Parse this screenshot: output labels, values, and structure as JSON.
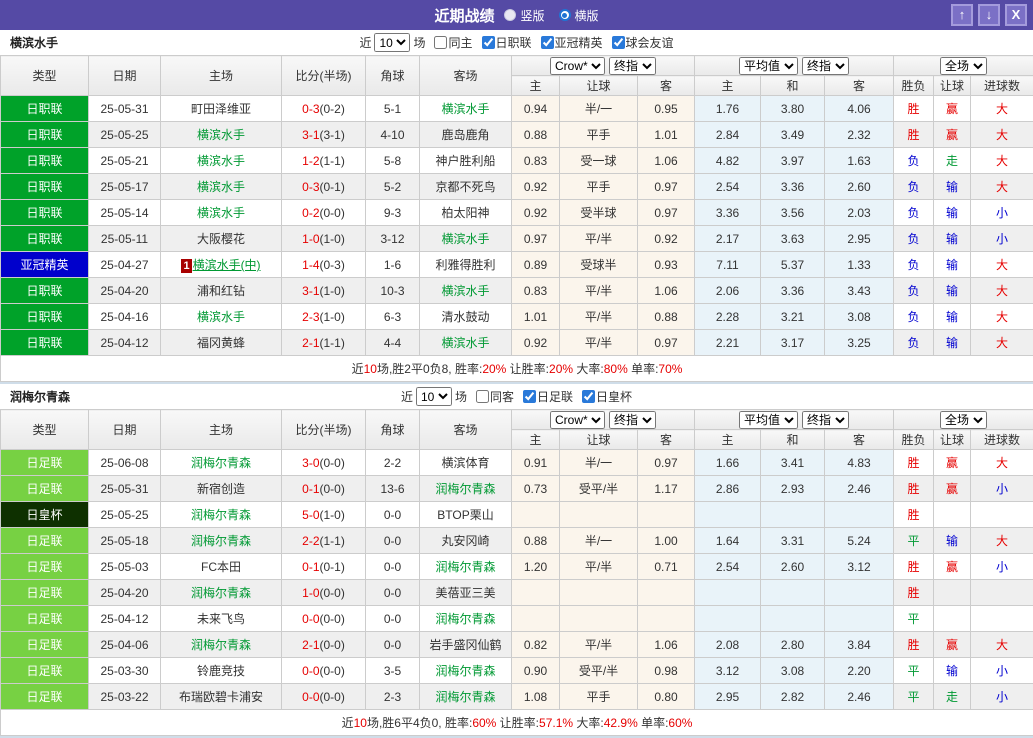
{
  "titlebar": {
    "title": "近期战绩",
    "radios": [
      {
        "label": "竖版",
        "selected": false
      },
      {
        "label": "横版",
        "selected": true
      }
    ],
    "buttons": {
      "up": "↑",
      "down": "↓",
      "close": "X"
    }
  },
  "colors": {
    "header_purple": "#554aa5",
    "badge": {
      "日职联": "#00a229",
      "亚冠精英": "#0000cc",
      "日足联": "#77d143",
      "日皇杯": "#0e3000"
    },
    "score_red": "#e60000",
    "team_green": "#009933",
    "result_red": "#e60000",
    "result_blue": "#0000d0",
    "result_green": "#009933"
  },
  "table_headers": {
    "main": [
      "类型",
      "日期",
      "主场",
      "比分(半场)",
      "角球",
      "客场"
    ],
    "sub": [
      "主",
      "让球",
      "客",
      "主",
      "和",
      "客",
      "胜负",
      "让球",
      "进球数"
    ],
    "group_selects": {
      "crow": [
        "Crow*",
        "终指"
      ],
      "avg": [
        "平均值",
        "终指"
      ],
      "result": [
        "全场"
      ]
    }
  },
  "sections": [
    {
      "team": "横滨水手",
      "filter": {
        "near_label": "近",
        "count": "10",
        "unit_label": "场",
        "checkboxes": [
          {
            "label": "同主",
            "checked": false
          },
          {
            "label": "日职联",
            "checked": true
          },
          {
            "label": "亚冠精英",
            "checked": true
          },
          {
            "label": "球会友谊",
            "checked": true
          }
        ]
      },
      "rows": [
        {
          "type": "日职联",
          "date": "25-05-31",
          "home": {
            "name": "町田泽维亚"
          },
          "score": "0-3",
          "half": "(0-2)",
          "corner": "5-1",
          "away": {
            "name": "横滨水手",
            "hl": true
          },
          "odds": [
            "0.94",
            "半/一",
            "0.95"
          ],
          "avg": [
            "1.76",
            "3.80",
            "4.06"
          ],
          "results": [
            "胜",
            "赢",
            "大"
          ]
        },
        {
          "type": "日职联",
          "date": "25-05-25",
          "home": {
            "name": "横滨水手",
            "hl": true
          },
          "score": "3-1",
          "half": "(3-1)",
          "corner": "4-10",
          "away": {
            "name": "鹿岛鹿角"
          },
          "odds": [
            "0.88",
            "平手",
            "1.01"
          ],
          "avg": [
            "2.84",
            "3.49",
            "2.32"
          ],
          "results": [
            "胜",
            "赢",
            "大"
          ]
        },
        {
          "type": "日职联",
          "date": "25-05-21",
          "home": {
            "name": "横滨水手",
            "hl": true
          },
          "score": "1-2",
          "half": "(1-1)",
          "corner": "5-8",
          "away": {
            "name": "神户胜利船"
          },
          "odds": [
            "0.83",
            "受一球",
            "1.06"
          ],
          "avg": [
            "4.82",
            "3.97",
            "1.63"
          ],
          "results": [
            "负",
            "走",
            "大"
          ]
        },
        {
          "type": "日职联",
          "date": "25-05-17",
          "home": {
            "name": "横滨水手",
            "hl": true
          },
          "score": "0-3",
          "half": "(0-1)",
          "corner": "5-2",
          "away": {
            "name": "京都不死鸟"
          },
          "odds": [
            "0.92",
            "平手",
            "0.97"
          ],
          "avg": [
            "2.54",
            "3.36",
            "2.60"
          ],
          "results": [
            "负",
            "输",
            "大"
          ]
        },
        {
          "type": "日职联",
          "date": "25-05-14",
          "home": {
            "name": "横滨水手",
            "hl": true
          },
          "score": "0-2",
          "half": "(0-0)",
          "corner": "9-3",
          "away": {
            "name": "柏太阳神"
          },
          "odds": [
            "0.92",
            "受半球",
            "0.97"
          ],
          "avg": [
            "3.36",
            "3.56",
            "2.03"
          ],
          "results": [
            "负",
            "输",
            "小"
          ]
        },
        {
          "type": "日职联",
          "date": "25-05-11",
          "home": {
            "name": "大阪樱花"
          },
          "score": "1-0",
          "half": "(1-0)",
          "corner": "3-12",
          "away": {
            "name": "横滨水手",
            "hl": true
          },
          "odds": [
            "0.97",
            "平/半",
            "0.92"
          ],
          "avg": [
            "2.17",
            "3.63",
            "2.95"
          ],
          "results": [
            "负",
            "输",
            "小"
          ]
        },
        {
          "type": "亚冠精英",
          "date": "25-04-27",
          "home": {
            "name": "横滨水手(中)",
            "hl": true,
            "mark": "1",
            "underline": true
          },
          "score": "1-4",
          "half": "(0-3)",
          "corner": "1-6",
          "away": {
            "name": "利雅得胜利"
          },
          "odds": [
            "0.89",
            "受球半",
            "0.93"
          ],
          "avg": [
            "7.11",
            "5.37",
            "1.33"
          ],
          "results": [
            "负",
            "输",
            "大"
          ]
        },
        {
          "type": "日职联",
          "date": "25-04-20",
          "home": {
            "name": "浦和红钻"
          },
          "score": "3-1",
          "half": "(1-0)",
          "corner": "10-3",
          "away": {
            "name": "横滨水手",
            "hl": true
          },
          "odds": [
            "0.83",
            "平/半",
            "1.06"
          ],
          "avg": [
            "2.06",
            "3.36",
            "3.43"
          ],
          "results": [
            "负",
            "输",
            "大"
          ]
        },
        {
          "type": "日职联",
          "date": "25-04-16",
          "home": {
            "name": "横滨水手",
            "hl": true
          },
          "score": "2-3",
          "half": "(1-0)",
          "corner": "6-3",
          "away": {
            "name": "清水鼓动"
          },
          "odds": [
            "1.01",
            "平/半",
            "0.88"
          ],
          "avg": [
            "2.28",
            "3.21",
            "3.08"
          ],
          "results": [
            "负",
            "输",
            "大"
          ]
        },
        {
          "type": "日职联",
          "date": "25-04-12",
          "home": {
            "name": "福冈黄蜂"
          },
          "score": "2-1",
          "half": "(1-1)",
          "corner": "4-4",
          "away": {
            "name": "横滨水手",
            "hl": true
          },
          "odds": [
            "0.92",
            "平/半",
            "0.97"
          ],
          "avg": [
            "2.21",
            "3.17",
            "3.25"
          ],
          "results": [
            "负",
            "输",
            "大"
          ]
        }
      ],
      "summary": [
        {
          "t": "近"
        },
        {
          "t": "10",
          "red": true
        },
        {
          "t": "场,胜2平0负8, 胜率:"
        },
        {
          "t": "20%",
          "red": true
        },
        {
          "t": " 让胜率:"
        },
        {
          "t": "20%",
          "red": true
        },
        {
          "t": " 大率:"
        },
        {
          "t": "80%",
          "red": true
        },
        {
          "t": " 单率:"
        },
        {
          "t": "70%",
          "red": true
        }
      ]
    },
    {
      "team": "润梅尔青森",
      "filter": {
        "near_label": "近",
        "count": "10",
        "unit_label": "场",
        "checkboxes": [
          {
            "label": "同客",
            "checked": false
          },
          {
            "label": "日足联",
            "checked": true
          },
          {
            "label": "日皇杯",
            "checked": true
          }
        ]
      },
      "rows": [
        {
          "type": "日足联",
          "date": "25-06-08",
          "home": {
            "name": "润梅尔青森",
            "hl": true
          },
          "score": "3-0",
          "half": "(0-0)",
          "corner": "2-2",
          "away": {
            "name": "横滨体育"
          },
          "odds": [
            "0.91",
            "半/一",
            "0.97"
          ],
          "avg": [
            "1.66",
            "3.41",
            "4.83"
          ],
          "results": [
            "胜",
            "赢",
            "大"
          ]
        },
        {
          "type": "日足联",
          "date": "25-05-31",
          "home": {
            "name": "新宿创造"
          },
          "score": "0-1",
          "half": "(0-0)",
          "corner": "13-6",
          "away": {
            "name": "润梅尔青森",
            "hl": true
          },
          "odds": [
            "0.73",
            "受平/半",
            "1.17"
          ],
          "avg": [
            "2.86",
            "2.93",
            "2.46"
          ],
          "results": [
            "胜",
            "赢",
            "小"
          ]
        },
        {
          "type": "日皇杯",
          "date": "25-05-25",
          "home": {
            "name": "润梅尔青森",
            "hl": true
          },
          "score": "5-0",
          "half": "(1-0)",
          "corner": "0-0",
          "away": {
            "name": "BTOP栗山"
          },
          "odds": [
            "",
            "",
            ""
          ],
          "avg": [
            "",
            "",
            ""
          ],
          "results": [
            "胜",
            "",
            ""
          ]
        },
        {
          "type": "日足联",
          "date": "25-05-18",
          "home": {
            "name": "润梅尔青森",
            "hl": true
          },
          "score": "2-2",
          "half": "(1-1)",
          "corner": "0-0",
          "away": {
            "name": "丸安冈崎"
          },
          "odds": [
            "0.88",
            "半/一",
            "1.00"
          ],
          "avg": [
            "1.64",
            "3.31",
            "5.24"
          ],
          "results": [
            "平",
            "输",
            "大"
          ]
        },
        {
          "type": "日足联",
          "date": "25-05-03",
          "home": {
            "name": "FC本田"
          },
          "score": "0-1",
          "half": "(0-1)",
          "corner": "0-0",
          "away": {
            "name": "润梅尔青森",
            "hl": true
          },
          "odds": [
            "1.20",
            "平/半",
            "0.71"
          ],
          "avg": [
            "2.54",
            "2.60",
            "3.12"
          ],
          "results": [
            "胜",
            "赢",
            "小"
          ]
        },
        {
          "type": "日足联",
          "date": "25-04-20",
          "home": {
            "name": "润梅尔青森",
            "hl": true
          },
          "score": "1-0",
          "half": "(0-0)",
          "corner": "0-0",
          "away": {
            "name": "美蓓亚三美"
          },
          "odds": [
            "",
            "",
            ""
          ],
          "avg": [
            "",
            "",
            ""
          ],
          "results": [
            "胜",
            "",
            ""
          ]
        },
        {
          "type": "日足联",
          "date": "25-04-12",
          "home": {
            "name": "未来飞鸟"
          },
          "score": "0-0",
          "half": "(0-0)",
          "corner": "0-0",
          "away": {
            "name": "润梅尔青森",
            "hl": true
          },
          "odds": [
            "",
            "",
            ""
          ],
          "avg": [
            "",
            "",
            ""
          ],
          "results": [
            "平",
            "",
            ""
          ]
        },
        {
          "type": "日足联",
          "date": "25-04-06",
          "home": {
            "name": "润梅尔青森",
            "hl": true
          },
          "score": "2-1",
          "half": "(0-0)",
          "corner": "0-0",
          "away": {
            "name": "岩手盛冈仙鹤"
          },
          "odds": [
            "0.82",
            "平/半",
            "1.06"
          ],
          "avg": [
            "2.08",
            "2.80",
            "3.84"
          ],
          "results": [
            "胜",
            "赢",
            "大"
          ]
        },
        {
          "type": "日足联",
          "date": "25-03-30",
          "home": {
            "name": "铃鹿竞技"
          },
          "score": "0-0",
          "half": "(0-0)",
          "corner": "3-5",
          "away": {
            "name": "润梅尔青森",
            "hl": true
          },
          "odds": [
            "0.90",
            "受平/半",
            "0.98"
          ],
          "avg": [
            "3.12",
            "3.08",
            "2.20"
          ],
          "results": [
            "平",
            "输",
            "小"
          ]
        },
        {
          "type": "日足联",
          "date": "25-03-22",
          "home": {
            "name": "布瑞欧碧卡浦安"
          },
          "score": "0-0",
          "half": "(0-0)",
          "corner": "2-3",
          "away": {
            "name": "润梅尔青森",
            "hl": true
          },
          "odds": [
            "1.08",
            "平手",
            "0.80"
          ],
          "avg": [
            "2.95",
            "2.82",
            "2.46"
          ],
          "results": [
            "平",
            "走",
            "小"
          ]
        }
      ],
      "summary": [
        {
          "t": "近"
        },
        {
          "t": "10",
          "red": true
        },
        {
          "t": "场,胜6平4负0, 胜率:"
        },
        {
          "t": "60%",
          "red": true
        },
        {
          "t": " 让胜率:"
        },
        {
          "t": "57.1%",
          "red": true
        },
        {
          "t": " 大率:"
        },
        {
          "t": "42.9%",
          "red": true
        },
        {
          "t": " 单率:"
        },
        {
          "t": "60%",
          "red": true
        }
      ]
    }
  ]
}
